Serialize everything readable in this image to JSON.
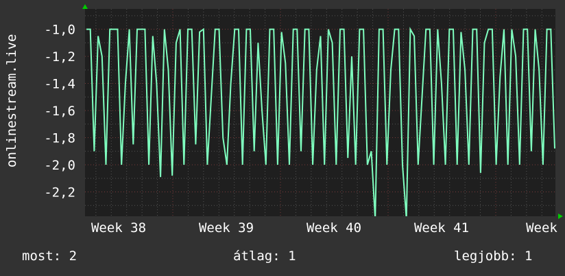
{
  "chart_data": {
    "type": "line",
    "title": "",
    "ylabel": "onlinestream.live",
    "xlabel": "",
    "ylim": [
      -2.38,
      -0.85
    ],
    "yticks": [
      -1.0,
      -1.2,
      -1.4,
      -1.6,
      -1.8,
      -2.0,
      -2.2
    ],
    "ytick_labels": [
      "-1,0",
      "-1,2",
      "-1,4",
      "-1,6",
      "-1,8",
      "-2,0",
      "-2,2"
    ],
    "xtick_labels": [
      "Week 38",
      "Week 39",
      "Week 40",
      "Week 41",
      "Week"
    ],
    "grid": true,
    "line_color": "#7fffbf",
    "series": [
      {
        "name": "onlinestream.live",
        "values": [
          -1,
          -1,
          -1.9,
          -1.05,
          -1.2,
          -2,
          -1,
          -1,
          -1,
          -2,
          -1.4,
          -1.0,
          -1.85,
          -1,
          -1,
          -1,
          -2,
          -1.05,
          -1.4,
          -2.09,
          -1,
          -1.3,
          -2.08,
          -1.1,
          -1,
          -2,
          -1,
          -1,
          -1.85,
          -1.02,
          -1,
          -2,
          -1.5,
          -1,
          -1,
          -1.8,
          -2,
          -1.4,
          -1,
          -1,
          -2,
          -1,
          -1,
          -1.9,
          -1.1,
          -1.6,
          -2,
          -1,
          -1,
          -2,
          -1.02,
          -1.25,
          -2,
          -1,
          -1,
          -1.9,
          -1,
          -1,
          -2,
          -1.3,
          -1.05,
          -2,
          -1,
          -1.1,
          -2,
          -1,
          -1,
          -1.95,
          -1.2,
          -2,
          -1,
          -1,
          -2,
          -1.9,
          -2.4,
          -1,
          -1,
          -2,
          -1.3,
          -1,
          -1,
          -2,
          -2.4,
          -1,
          -1.05,
          -2,
          -1.5,
          -1,
          -1,
          -2,
          -1,
          -1.4,
          -2,
          -1,
          -1,
          -2,
          -1.02,
          -1.3,
          -2,
          -1,
          -1,
          -2.06,
          -1.1,
          -1,
          -1,
          -2,
          -1.35,
          -1,
          -2,
          -1,
          -1.2,
          -2,
          -1,
          -1,
          -1.9,
          -1,
          -1.3,
          -2,
          -1,
          -1,
          -1.88
        ]
      }
    ]
  },
  "footer": {
    "current": "most: 2",
    "average": "átlag: 1",
    "best": "legjobb: 1"
  }
}
